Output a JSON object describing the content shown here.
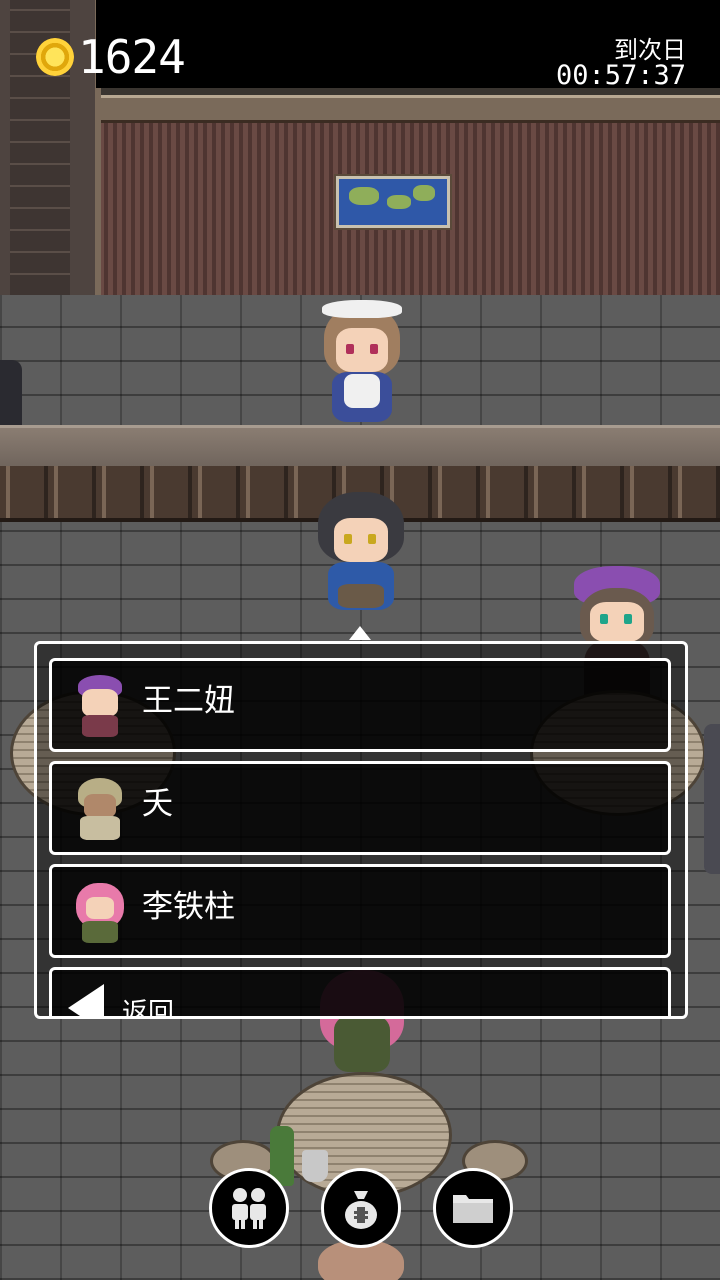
{
  "hud": {
    "coins": "1624",
    "timer_label": "到次日",
    "timer_value": "00:57:37"
  },
  "menu": {
    "options": [
      {
        "label": "王二妞",
        "portrait": "purple-hat-girl-portrait"
      },
      {
        "label": "夭",
        "portrait": "hooded-girl-portrait"
      },
      {
        "label": "李铁柱",
        "portrait": "pink-hair-girl-portrait"
      }
    ],
    "back_label": "返回"
  },
  "bottom_bar": {
    "buttons": [
      {
        "icon": "party-icon"
      },
      {
        "icon": "money-bag-icon"
      },
      {
        "icon": "folder-icon"
      }
    ]
  }
}
